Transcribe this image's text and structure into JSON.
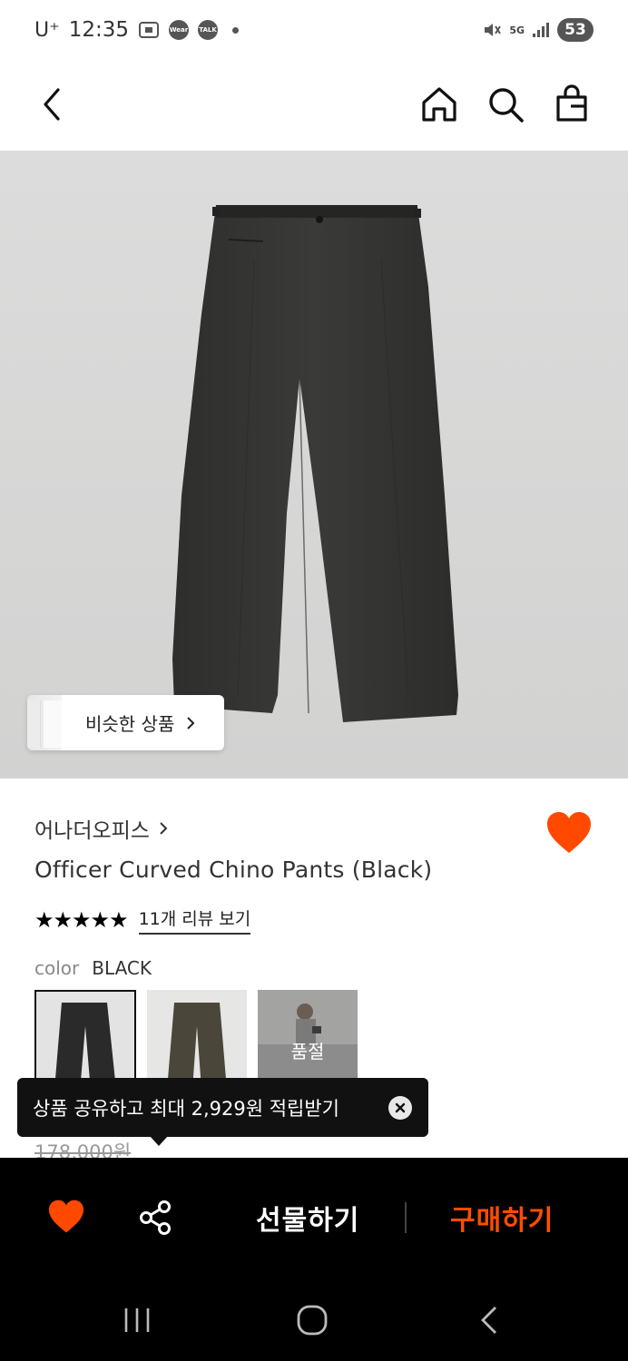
{
  "status_bar": {
    "carrier": "U⁺",
    "time": "12:35",
    "wear_label": "Wear",
    "talk_label": "TALK",
    "network": "5G",
    "battery": "53"
  },
  "header": {
    "back_icon": "chevron-left-icon",
    "home_icon": "home-icon",
    "search_icon": "search-icon",
    "cart_icon": "shopping-bag-icon"
  },
  "product": {
    "similar_label": "비슷한 상품",
    "brand": "어나더오피스",
    "title": "Officer Curved Chino Pants (Black)",
    "stars": "★★★★★",
    "review_link": "11개 리뷰 보기",
    "color_label": "color",
    "color_value": "BLACK",
    "swatches": [
      {
        "name": "black",
        "selected": true
      },
      {
        "name": "olive",
        "selected": false
      },
      {
        "name": "model",
        "sold_out_label": "품절"
      }
    ],
    "original_price": "178,000원"
  },
  "tooltip": {
    "text": "상품 공유하고 최대 2,929원 적립받기"
  },
  "bottom_bar": {
    "gift_label": "선물하기",
    "buy_label": "구매하기"
  },
  "colors": {
    "accent": "#ff4d00",
    "heart": "#ff4800",
    "bar_bg": "#000000"
  }
}
